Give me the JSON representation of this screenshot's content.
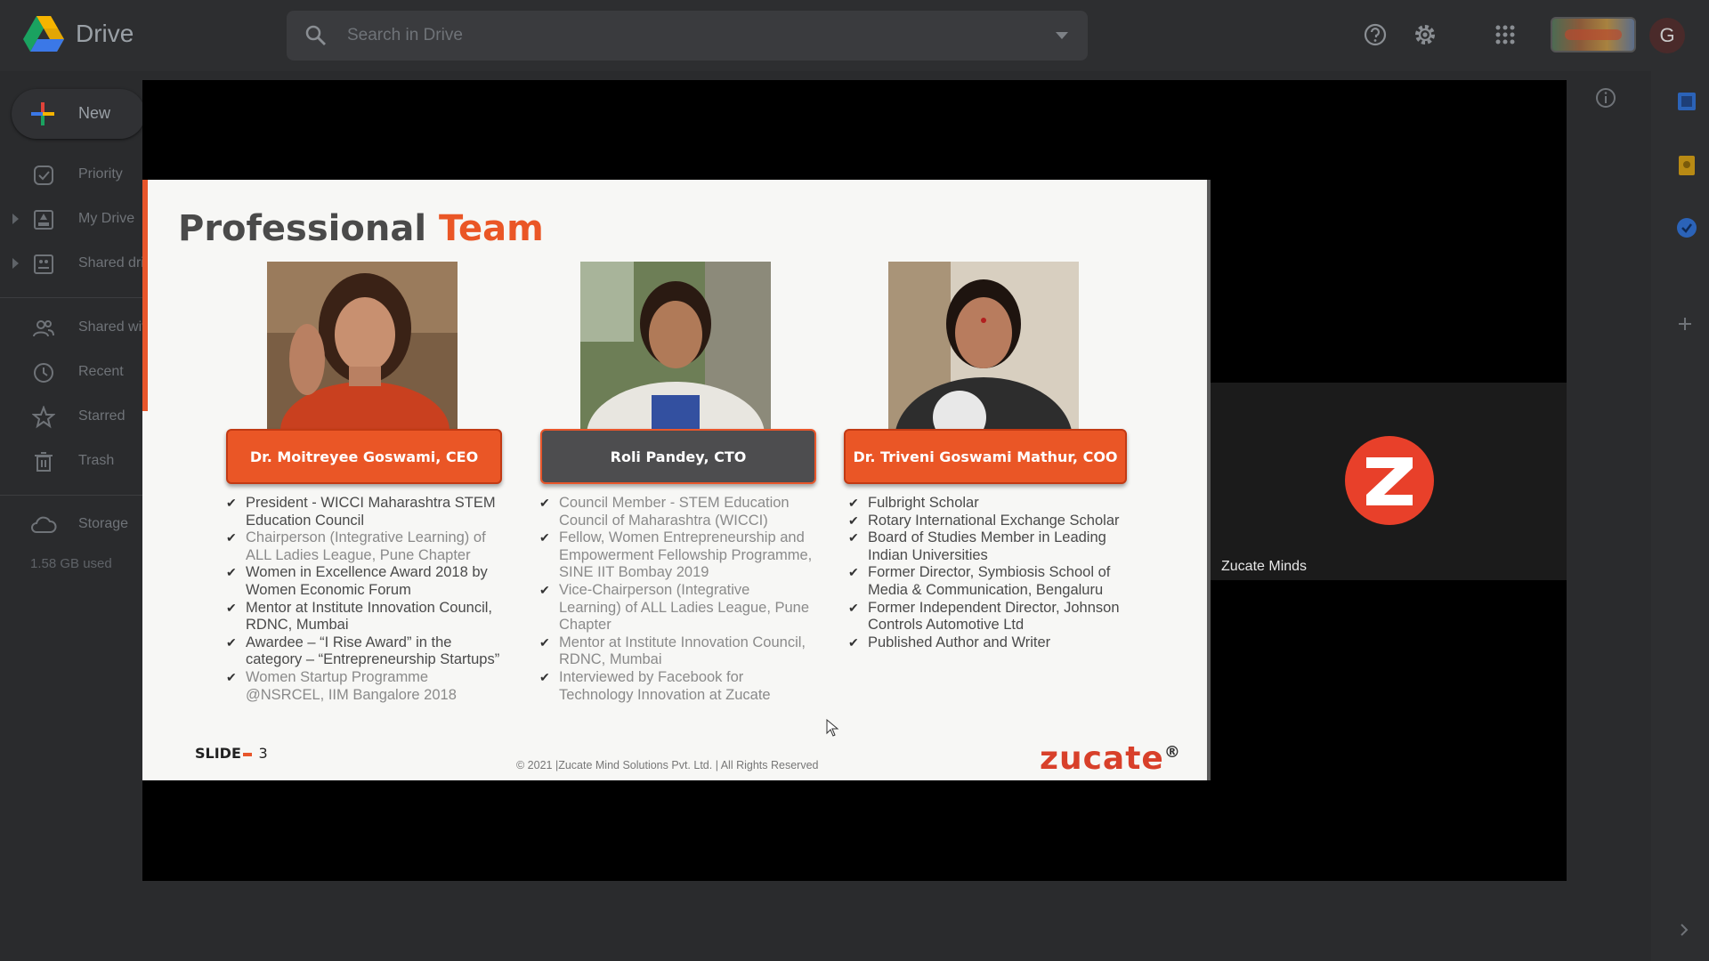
{
  "app": {
    "name": "Drive",
    "search_placeholder": "Search in Drive",
    "avatar_letter": "G"
  },
  "sidebar": {
    "new_label": "New",
    "items": [
      {
        "label": "Priority",
        "icon": "priority-icon"
      },
      {
        "label": "My Drive",
        "icon": "my-drive-icon"
      },
      {
        "label": "Shared drives",
        "icon": "shared-drives-icon"
      },
      {
        "label": "Shared with me",
        "icon": "shared-with-me-icon"
      },
      {
        "label": "Recent",
        "icon": "recent-icon"
      },
      {
        "label": "Starred",
        "icon": "star-icon"
      },
      {
        "label": "Trash",
        "icon": "trash-icon"
      },
      {
        "label": "Storage",
        "icon": "cloud-icon"
      }
    ],
    "storage_used": "1.58 GB used"
  },
  "slide": {
    "title_part1": "Professional",
    "title_part2": "Team",
    "members": [
      {
        "name": "Dr. Moitreyee Goswami, CEO",
        "bullets": [
          "President - WICCI Maharashtra STEM Education Council",
          "Chairperson (Integrative Learning) of ALL Ladies League, Pune Chapter",
          "Women in Excellence Award 2018 by Women Economic Forum",
          "Mentor at Institute Innovation Council, RDNC, Mumbai",
          "Awardee – “I Rise Award” in the category – “Entrepreneurship Startups”",
          "Women Startup Programme @NSRCEL, IIM Bangalore 2018"
        ]
      },
      {
        "name": "Roli Pandey, CTO",
        "bullets": [
          "Council Member - STEM Education Council of Maharashtra (WICCI)",
          "Fellow, Women Entrepreneurship and Empowerment Fellowship Programme, SINE IIT Bombay 2019",
          "Vice-Chairperson (Integrative Learning) of ALL Ladies League, Pune Chapter",
          "Mentor at Institute Innovation Council, RDNC, Mumbai",
          "Interviewed by Facebook for Technology Innovation at Zucate"
        ]
      },
      {
        "name": "Dr. Triveni Goswami Mathur, COO",
        "bullets": [
          "Fulbright Scholar",
          "Rotary International Exchange Scholar",
          "Board of Studies Member in Leading Indian Universities",
          "Former Director, Symbiosis School of Media & Communication, Bengaluru",
          "Former Independent Director, Johnson Controls Automotive Ltd",
          "Published Author and Writer"
        ]
      }
    ],
    "slide_label": "SLIDE",
    "slide_number": "3",
    "copyright": "© 2021 |Zucate Mind Solutions Pvt. Ltd. | All Rights Reserved",
    "brand": "zucate",
    "brand_mark": "®"
  },
  "participant": {
    "name": "Zucate Minds"
  },
  "colors": {
    "accent": "#ea5626",
    "dark_text": "#4a4a4a",
    "light_text": "#8a8a8a"
  }
}
